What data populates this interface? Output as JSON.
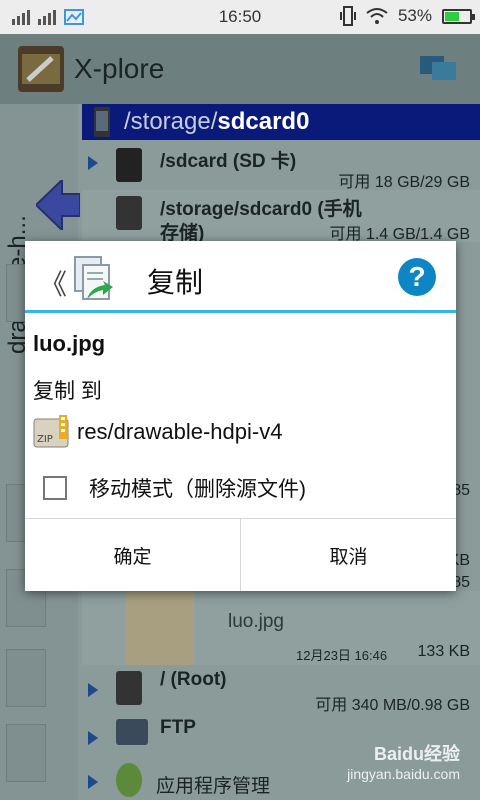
{
  "status_bar": {
    "time": "16:50",
    "battery_percent": "53%",
    "battery_level": 0.53
  },
  "app": {
    "title": "X-plore",
    "side_tab_label": "drawable-h..."
  },
  "pane": {
    "path_prefix": "/storage/",
    "path_bold": "sdcard0",
    "items": [
      {
        "name": "/sdcard (SD 卡)",
        "meta": "可用 18 GB/29 GB"
      },
      {
        "name": "/storage/sdcard0 (手机",
        "name2": "存储)",
        "meta": "可用 1.4 GB/1.4 GB"
      },
      {
        "name": "luo.jpg",
        "meta": "133 KB",
        "date": "12月23日 16:46"
      },
      {
        "name": "/ (Root)",
        "meta": "可用 340 MB/0.98 GB"
      },
      {
        "name": "FTP",
        "meta": ""
      },
      {
        "name": "应用程序管理",
        "meta": ""
      }
    ],
    "partial_values": [
      "85",
      "KB",
      "85"
    ]
  },
  "dialog": {
    "title": "复制",
    "help_label": "?",
    "file_name": "luo.jpg",
    "copy_to_label": "复制 到",
    "target_path": "res/drawable-hdpi-v4",
    "move_mode_label": "移动模式（删除源文件)",
    "move_mode_checked": false,
    "ok_label": "确定",
    "cancel_label": "取消"
  },
  "watermark": {
    "brand": "Baidu经验",
    "url": "jingyan.baidu.com"
  },
  "colors": {
    "accent_line": "#33b5e5",
    "path_bar": "#0a1a7a",
    "help_icon": "#0e86c6"
  }
}
